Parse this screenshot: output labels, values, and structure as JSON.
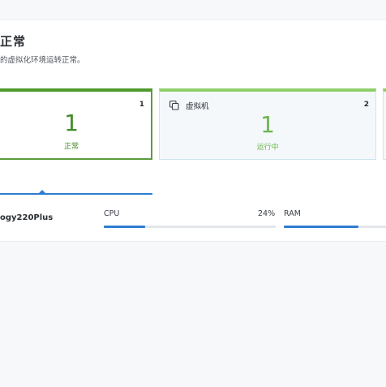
{
  "summary": {
    "title": "正常",
    "description": "的虚拟化环境运转正常。"
  },
  "cards": {
    "health": {
      "count": "1",
      "number": "1",
      "status": "正常"
    },
    "vm": {
      "label": "虚拟机",
      "icon": "copy-icon",
      "count": "2",
      "number": "1",
      "status": "运行中"
    }
  },
  "host": {
    "name": "ogy220Plus",
    "cpu_label": "CPU",
    "cpu_value": "24%",
    "cpu_fraction": 0.24,
    "ram_label": "RAM",
    "ram_fraction": 0.73
  },
  "colors": {
    "healthy_green": "#4e9a2e",
    "running_green": "#6cb54a",
    "accent_blue": "#2d7dd2"
  }
}
